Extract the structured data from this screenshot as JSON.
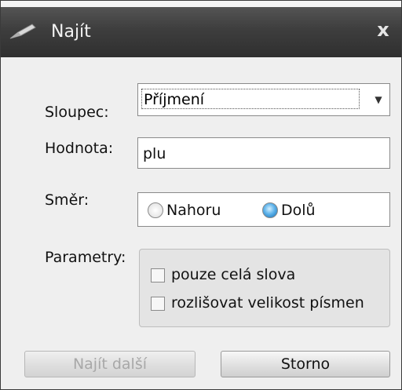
{
  "window": {
    "title": "Najít",
    "close_symbol": "x",
    "icon": "pen-icon"
  },
  "form": {
    "column_label": "Sloupec:",
    "column_value": "Příjmení",
    "value_label": "Hodnota:",
    "value_input": "plu",
    "direction_label": "Směr:",
    "direction_options": [
      {
        "label": "Nahoru",
        "checked": false
      },
      {
        "label": "Dolů",
        "checked": true
      }
    ],
    "params_label": "Parametry:",
    "params": [
      {
        "label": "pouze celá slova",
        "checked": false
      },
      {
        "label": "rozlišovat velikost písmen",
        "checked": false
      }
    ]
  },
  "buttons": {
    "find_next": "Najít další",
    "cancel": "Storno"
  },
  "colors": {
    "titlebar": "#3e3e3e",
    "radio_selected": "#2c86c8"
  }
}
